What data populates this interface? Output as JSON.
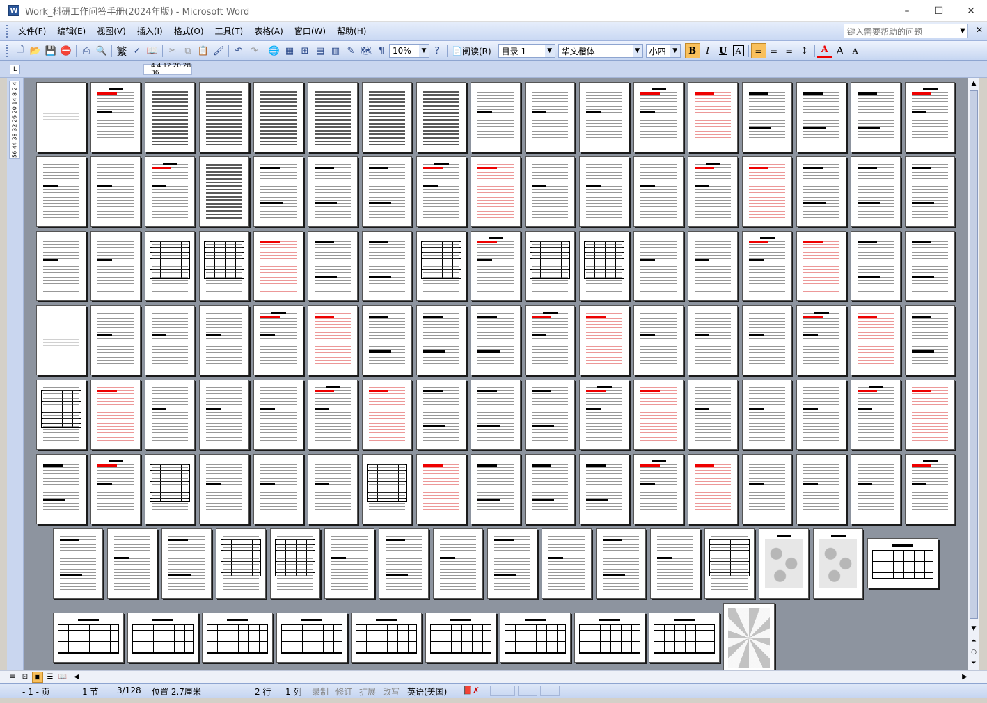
{
  "window": {
    "title": "Work_科研工作问答手册(2024年版) - Microsoft Word",
    "app_icon": "W"
  },
  "window_controls": {
    "minimize": "–",
    "maximize": "☐",
    "close": "✕"
  },
  "menu": {
    "items": [
      "文件(F)",
      "编辑(E)",
      "视图(V)",
      "插入(I)",
      "格式(O)",
      "工具(T)",
      "表格(A)",
      "窗口(W)",
      "帮助(H)"
    ],
    "help_placeholder": "键入需要帮助的问题",
    "close": "✕"
  },
  "toolbar": {
    "traditional": "繁",
    "zoom": "10%",
    "read_mode": "阅读(R)",
    "style": "目录 1",
    "font": "华文楷体",
    "size": "小四",
    "bold": "B",
    "italic": "I",
    "underline": "U",
    "char_border": "A",
    "font_color": "A",
    "grow_font": "A",
    "shrink_font": "A"
  },
  "ruler": {
    "corner": "L",
    "marks": "4 4 12 20 28 36"
  },
  "vruler": {
    "marks": "56 44 38 32 26 20 14 8 2 4"
  },
  "statusbar": {
    "page": "- 1 - 页",
    "section": "1 节",
    "page_count": "3/128",
    "position": "位置 2.7厘米",
    "line": "2 行",
    "column": "1 列",
    "rec": "录制",
    "trk": "修订",
    "ext": "扩展",
    "ovr": "改写",
    "language": "英语(美国)"
  },
  "colors": {
    "accent": "#2b579a",
    "doc_bg": "#8d949f",
    "red_text": "#e00000"
  }
}
